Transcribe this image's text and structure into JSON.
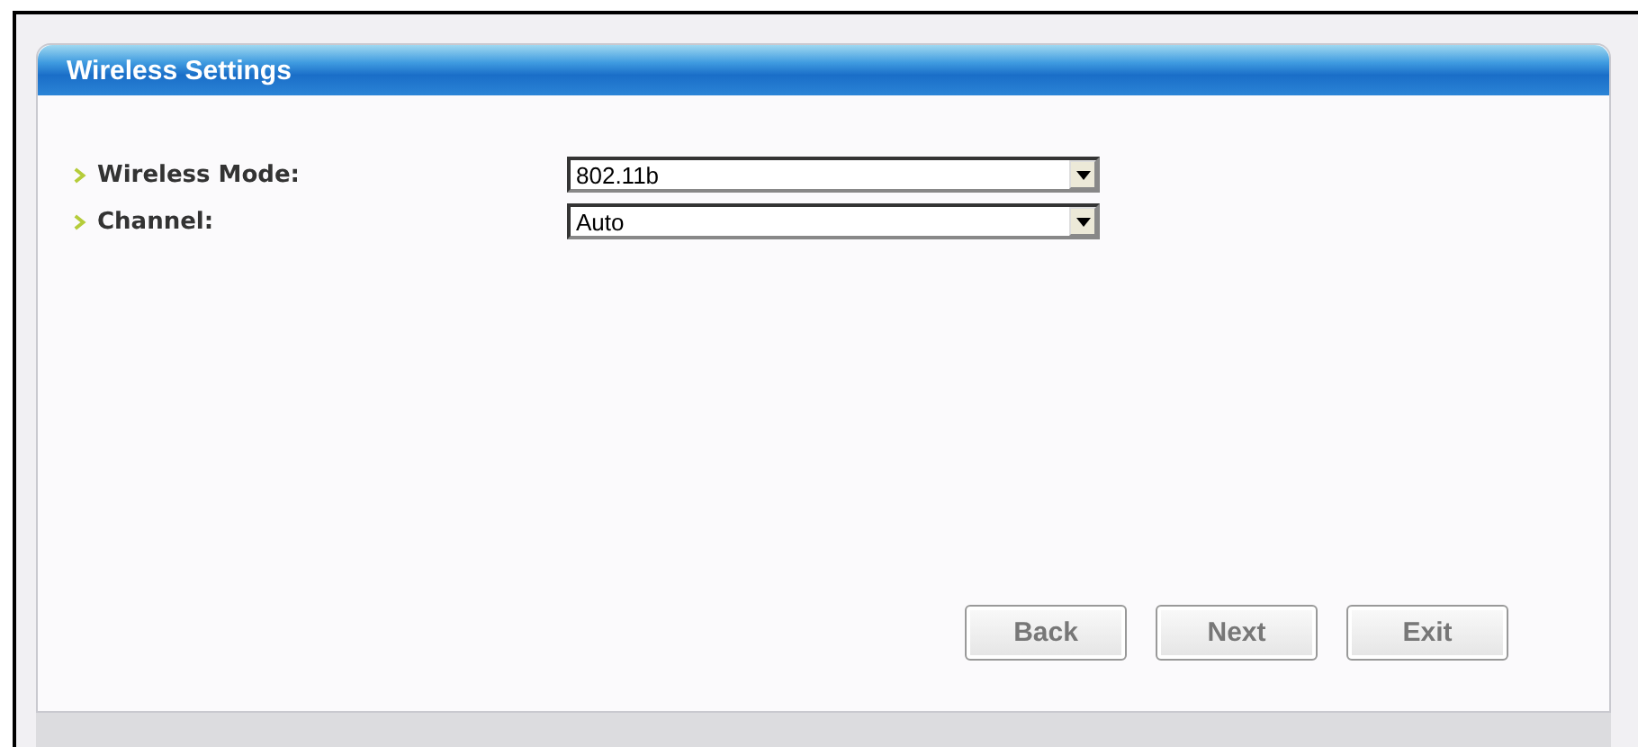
{
  "panel": {
    "title": "Wireless Settings"
  },
  "fields": [
    {
      "label": "Wireless Mode:",
      "value": "802.11b"
    },
    {
      "label": "Channel:",
      "value": "Auto"
    }
  ],
  "buttons": [
    "Back",
    "Next",
    "Exit"
  ]
}
